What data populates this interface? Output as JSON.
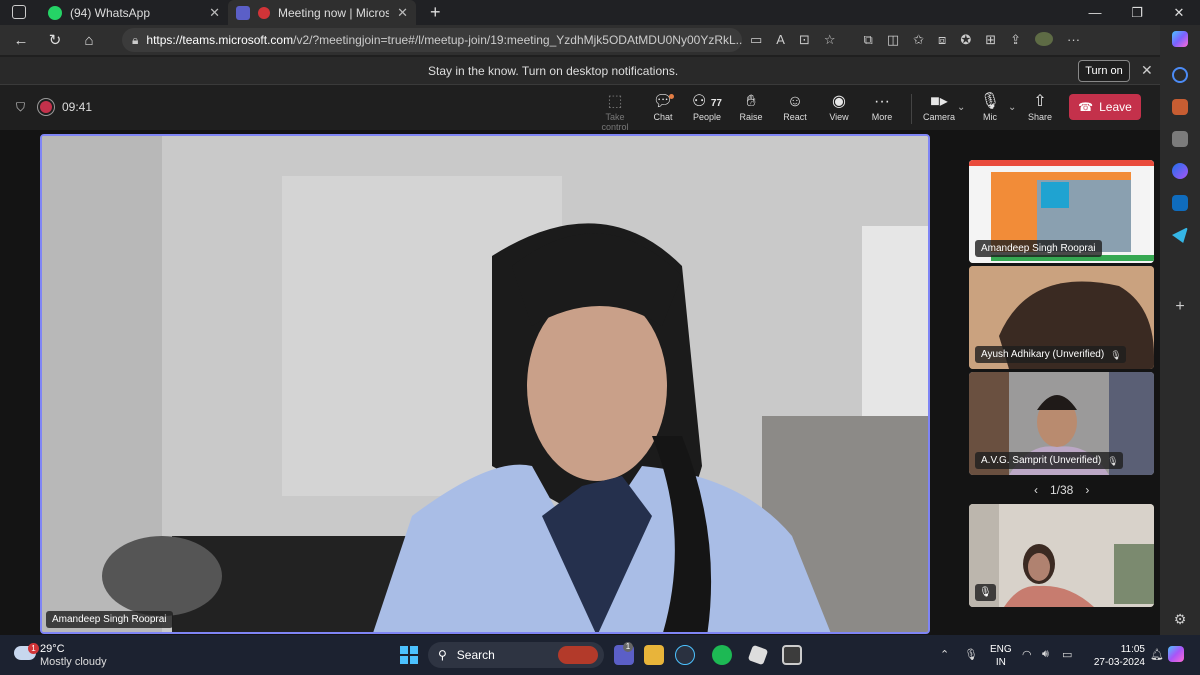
{
  "browser": {
    "tabs": [
      {
        "label": "(94) WhatsApp"
      },
      {
        "label": "Meeting now | Microsoft Tea"
      }
    ],
    "url_host": "https://teams.microsoft.com",
    "url_path": "/v2/?meetingjoin=true#/l/meetup-join/19:meeting_YzdhMjk5ODAtMDU0Ny00YzRkL..."
  },
  "notification": {
    "text": "Stay in the know. Turn on desktop notifications.",
    "button": "Turn on"
  },
  "meeting": {
    "timer": "09:41",
    "toolbar": {
      "take_control": "Take control",
      "chat": "Chat",
      "people": "People",
      "people_count": "77",
      "raise": "Raise",
      "react": "React",
      "view": "View",
      "more": "More",
      "camera": "Camera",
      "mic": "Mic",
      "share": "Share",
      "leave": "Leave"
    },
    "main_speaker": "Amandeep Singh Rooprai",
    "participants": [
      {
        "name": "Amandeep Singh Rooprai"
      },
      {
        "name": "Ayush Adhikary (Unverified)"
      },
      {
        "name": "A.V.G. Samprit (Unverified)"
      }
    ],
    "pager": "1/38"
  },
  "taskbar": {
    "temperature": "29°C",
    "condition": "Mostly cloudy",
    "weather_badge": "1",
    "search_placeholder": "Search",
    "teams_badge": "1",
    "lang_1": "ENG",
    "lang_2": "IN",
    "time": "11:05",
    "date": "27-03-2024"
  }
}
